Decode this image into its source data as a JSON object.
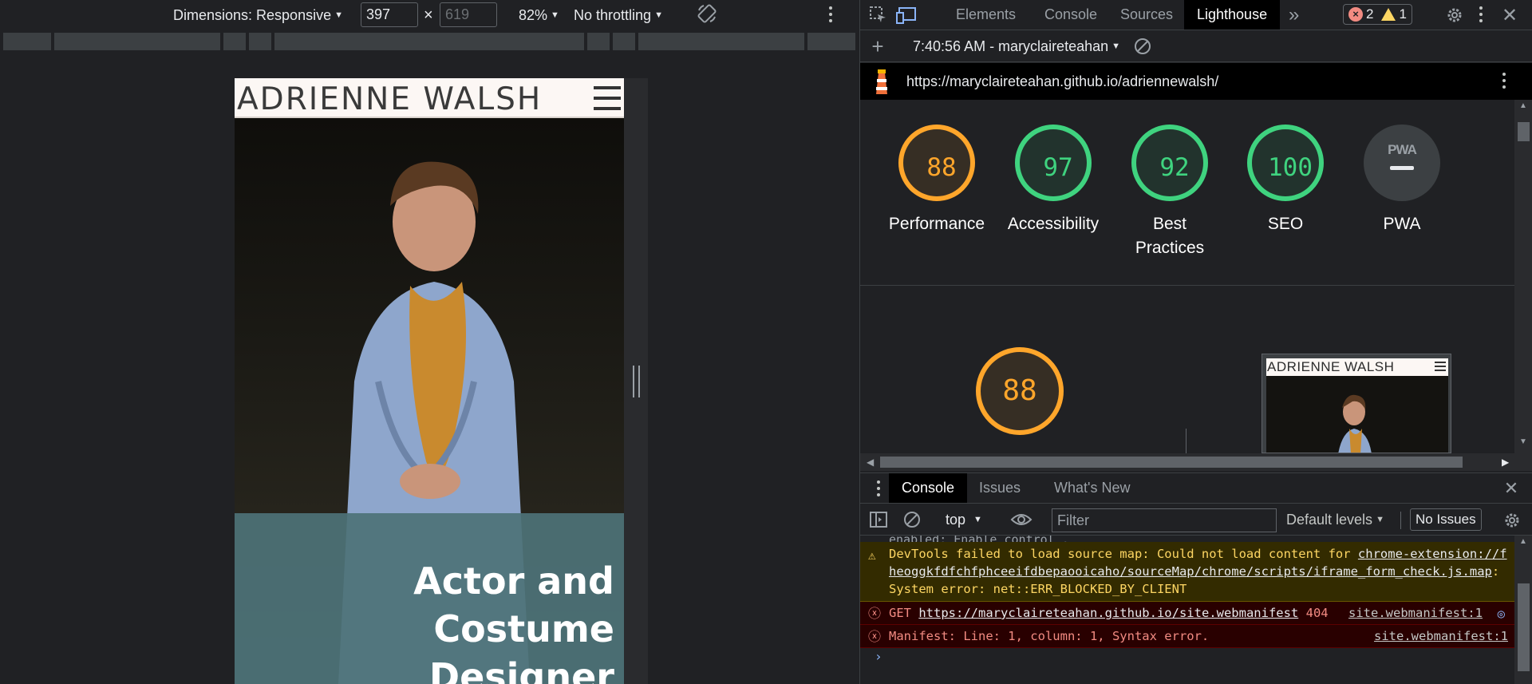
{
  "device_toolbar": {
    "dimensions_label": "Dimensions: Responsive",
    "width_value": "397",
    "times": "×",
    "height_value": "619",
    "zoom": "82%",
    "throttling": "No throttling"
  },
  "site": {
    "title": "ADRIENNE WALSH",
    "hero_text_line1": "Actor and Costume",
    "hero_text_line2": "Designer"
  },
  "devtools": {
    "tabs": [
      "Elements",
      "Console",
      "Sources",
      "Lighthouse"
    ],
    "more_tabs": "»",
    "error_count": "2",
    "warning_count": "1",
    "lighthouse": {
      "report_label": "7:40:56 AM - maryclaireteahan",
      "url": "https://maryclaireteahan.github.io/adriennewalsh/",
      "scores": [
        {
          "value": "88",
          "label": "Performance",
          "level": "average"
        },
        {
          "value": "97",
          "label": "Accessibility",
          "level": "pass"
        },
        {
          "value": "92",
          "label": "Best Practices",
          "level": "pass"
        },
        {
          "value": "100",
          "label": "SEO",
          "level": "pass"
        },
        {
          "value": "",
          "label": "PWA",
          "level": "na",
          "badge": "PWA"
        }
      ],
      "performance_detail": "88",
      "thumbnail_title": "ADRIENNE WALSH"
    },
    "drawer": {
      "tabs": [
        "Console",
        "Issues",
        "What's New"
      ],
      "context": "top",
      "filter_placeholder": "Filter",
      "levels": "Default levels",
      "issues": "No Issues",
      "messages": [
        {
          "type": "warn",
          "lines": [
            "DevTools failed to load source map: Could not load content for ",
            "chrome-extension://fheoggkfdfchfphceeifdbepaooicaho/sourceMap/chrome/scripts/iframe_form_check.js.map",
            ": System error: net::ERR_BLOCKED_BY_CLIENT"
          ]
        },
        {
          "type": "error",
          "method": "GET",
          "url": "https://maryclaireteahan.github.io/site.webmanifest",
          "status": "404",
          "source": "site.webmanifest:1"
        },
        {
          "type": "error",
          "text": "Manifest: Line: 1, column: 1, Syntax error.",
          "source": "site.webmanifest:1"
        }
      ],
      "truncated_top": "enabled: Enable control ."
    }
  },
  "colors": {
    "score_average": "#ffa62b",
    "score_pass": "#3fd37f",
    "site_header_bg": "#fcf7f4",
    "hero_overlay": "#4d7277"
  }
}
